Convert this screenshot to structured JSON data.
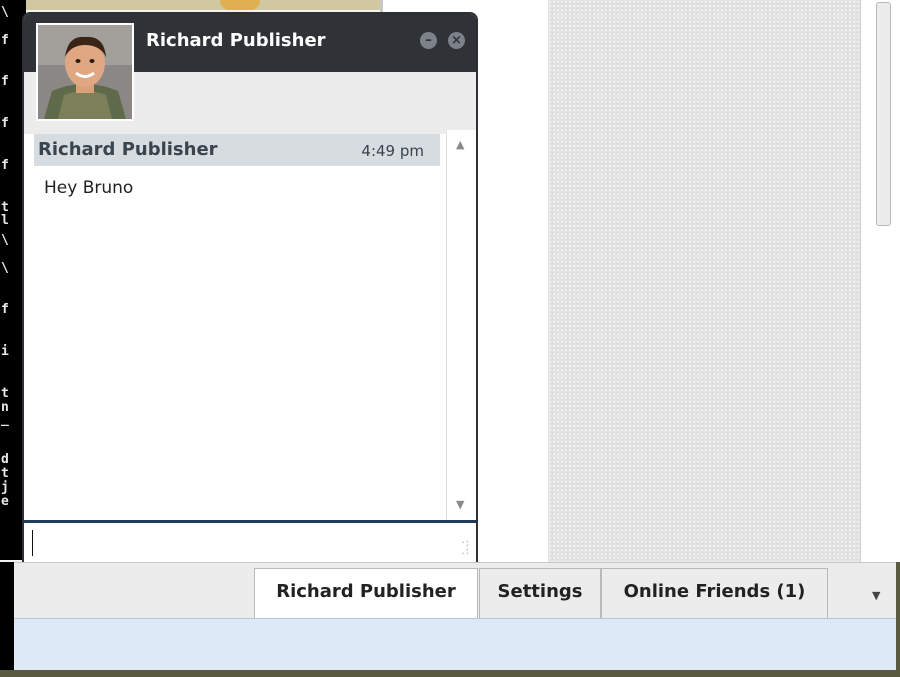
{
  "chat": {
    "contact_name": "Richard Publisher",
    "status": "...",
    "minimize_icon": "minimize-icon",
    "close_icon": "close-icon",
    "messages": [
      {
        "sender": "Richard Publisher",
        "time": "4:49 pm",
        "text": "Hey Bruno"
      }
    ],
    "input_value": ""
  },
  "terminal": {
    "lines": [
      "\\",
      "f",
      "f",
      "f",
      "f",
      "t",
      "l",
      "\\",
      "\\",
      "f",
      "i",
      "t",
      "n",
      "_",
      "d",
      "t",
      "j",
      "e"
    ]
  },
  "tabs": [
    {
      "label": "Richard Publisher",
      "active": true
    },
    {
      "label": "Settings",
      "active": false
    },
    {
      "label": "Online Friends (1)",
      "active": false
    }
  ],
  "colors": {
    "header_bg": "#2f3338",
    "message_header_bg": "#d6dce0",
    "bottom_bar_bg": "#dde9f6"
  }
}
